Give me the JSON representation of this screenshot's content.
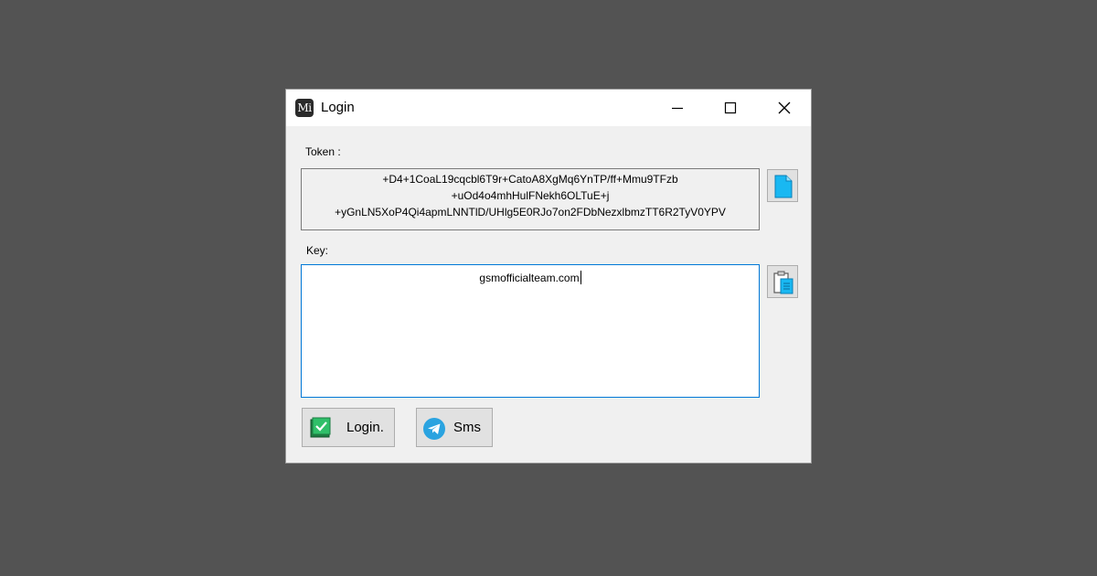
{
  "window": {
    "title": "Login",
    "app_icon_text": "Mi"
  },
  "title_controls": {
    "minimize": "minimize",
    "maximize": "maximize",
    "close": "close"
  },
  "token": {
    "label": "Token :",
    "lines": [
      "+D4+1CoaL19cqcbl6T9r+CatoA8XgMq6YnTP/ff+Mmu9TFzb",
      "+uOd4o4mhHulFNekh6OLTuE+j",
      "+yGnLN5XoP4Qi4apmLNNTlD/UHlg5E0RJo7on2FDbNezxlbmzTT6R2TyV0YPV"
    ]
  },
  "key": {
    "label": "Key:",
    "value": "gsmofficialteam.com"
  },
  "buttons": {
    "login": "Login.",
    "sms": "Sms"
  },
  "icons": {
    "copy_token": "document-icon",
    "paste_key": "clipboard-icon",
    "login": "checkmark-icon",
    "sms": "telegram-icon"
  },
  "colors": {
    "accent": "#0078d7",
    "telegram": "#2aa3e0",
    "login_check": "#22a35a"
  }
}
